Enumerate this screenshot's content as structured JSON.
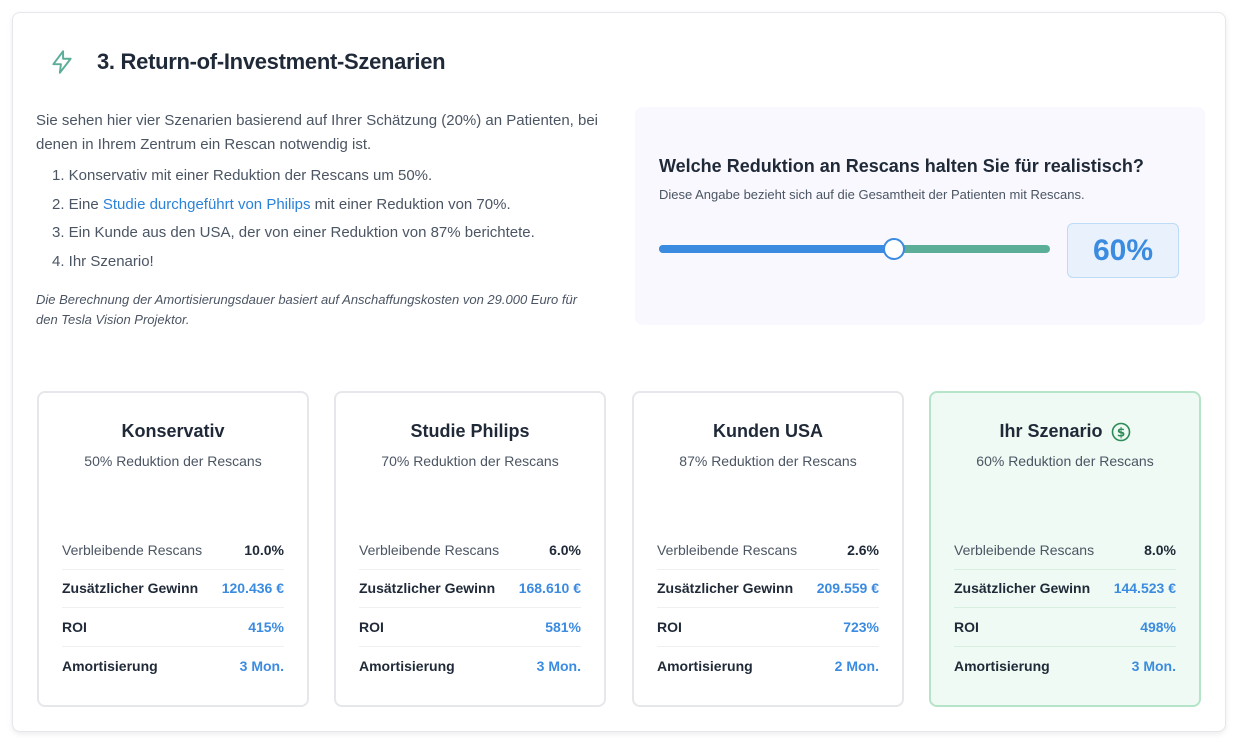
{
  "section": {
    "icon": "lightning-bolt-icon",
    "title": "3. Return-of-Investment-Szenarien"
  },
  "intro": {
    "text": "Sie sehen hier vier Szenarien basierend auf Ihrer Schätzung (20%) an Patienten, bei denen in Ihrem Zentrum ein Rescan notwendig ist.",
    "list": {
      "item1": "1. Konservativ mit einer Reduktion der Rescans um 50%.",
      "item2_prefix": "2. Eine ",
      "item2_link": "Studie durchgeführt von Philips",
      "item2_suffix": " mit einer Reduktion von 70%.",
      "item3": "3. Ein Kunde aus den USA, der von einer Reduktion von 87% berichtete.",
      "item4": "4. Ihr Szenario!"
    },
    "note": "Die Berechnung der Amortisierungsdauer basiert auf Anschaffungskosten von 29.000 Euro für den Tesla Vision Projektor."
  },
  "slider": {
    "question": "Welche Reduktion an Rescans halten Sie für realistisch?",
    "hint": "Diese Angabe bezieht sich auf die Gesamtheit der Patienten mit Rescans.",
    "value_display": "60%",
    "level": 0.6
  },
  "colors": {
    "accent_blue": "#3b8be0",
    "track_green": "#5cae98",
    "highlight_bg": "#eefaf3"
  },
  "cards": [
    {
      "title": "Konservativ",
      "subtitle": "50% Reduktion der Rescans",
      "rows": [
        {
          "label": "Verbleibende Rescans",
          "value": "10.0%"
        },
        {
          "label": "Zusätzlicher Gewinn",
          "value": "120.436 €"
        },
        {
          "label": "ROI",
          "value": "415%"
        },
        {
          "label": "Amortisierung",
          "value": "3 Mon."
        }
      ]
    },
    {
      "title": "Studie Philips",
      "subtitle": "70% Reduktion der Rescans",
      "rows": [
        {
          "label": "Verbleibende Rescans",
          "value": "6.0%"
        },
        {
          "label": "Zusätzlicher Gewinn",
          "value": "168.610 €"
        },
        {
          "label": "ROI",
          "value": "581%"
        },
        {
          "label": "Amortisierung",
          "value": "3 Mon."
        }
      ]
    },
    {
      "title": "Kunden USA",
      "subtitle": "87% Reduktion der Rescans",
      "rows": [
        {
          "label": "Verbleibende Rescans",
          "value": "2.6%"
        },
        {
          "label": "Zusätzlicher Gewinn",
          "value": "209.559 €"
        },
        {
          "label": "ROI",
          "value": "723%"
        },
        {
          "label": "Amortisierung",
          "value": "2 Mon."
        }
      ]
    },
    {
      "title": "Ihr Szenario",
      "icon": "dollar-circle-icon",
      "subtitle": "60% Reduktion der Rescans",
      "rows": [
        {
          "label": "Verbleibende Rescans",
          "value": "8.0%"
        },
        {
          "label": "Zusätzlicher Gewinn",
          "value": "144.523 €"
        },
        {
          "label": "ROI",
          "value": "498%"
        },
        {
          "label": "Amortisierung",
          "value": "3 Mon."
        }
      ]
    }
  ]
}
